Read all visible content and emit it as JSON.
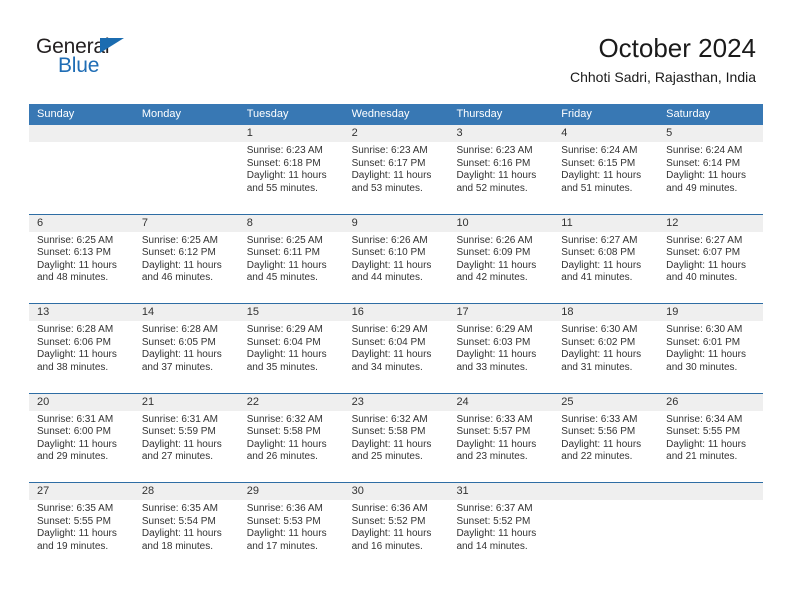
{
  "brand": {
    "name_part1": "General",
    "name_part2": "Blue"
  },
  "header": {
    "month_title": "October 2024",
    "location": "Chhoti Sadri, Rajasthan, India"
  },
  "colors": {
    "header_band": "#3878b4",
    "row_divider": "#2e6da4",
    "daynum_band": "#efefef",
    "brand_blue": "#1f6db5",
    "text": "#333333"
  },
  "day_names": [
    "Sunday",
    "Monday",
    "Tuesday",
    "Wednesday",
    "Thursday",
    "Friday",
    "Saturday"
  ],
  "labels": {
    "sunrise_prefix": "Sunrise:",
    "sunset_prefix": "Sunset:",
    "daylight_prefix": "Daylight:"
  },
  "weeks": [
    [
      {
        "empty": true,
        "day": "",
        "sunrise": "",
        "sunset": "",
        "daylight_line1": "",
        "daylight_line2": ""
      },
      {
        "empty": true,
        "day": "",
        "sunrise": "",
        "sunset": "",
        "daylight_line1": "",
        "daylight_line2": ""
      },
      {
        "empty": false,
        "day": "1",
        "sunrise": "Sunrise: 6:23 AM",
        "sunset": "Sunset: 6:18 PM",
        "daylight_line1": "Daylight: 11 hours",
        "daylight_line2": "and 55 minutes."
      },
      {
        "empty": false,
        "day": "2",
        "sunrise": "Sunrise: 6:23 AM",
        "sunset": "Sunset: 6:17 PM",
        "daylight_line1": "Daylight: 11 hours",
        "daylight_line2": "and 53 minutes."
      },
      {
        "empty": false,
        "day": "3",
        "sunrise": "Sunrise: 6:23 AM",
        "sunset": "Sunset: 6:16 PM",
        "daylight_line1": "Daylight: 11 hours",
        "daylight_line2": "and 52 minutes."
      },
      {
        "empty": false,
        "day": "4",
        "sunrise": "Sunrise: 6:24 AM",
        "sunset": "Sunset: 6:15 PM",
        "daylight_line1": "Daylight: 11 hours",
        "daylight_line2": "and 51 minutes."
      },
      {
        "empty": false,
        "day": "5",
        "sunrise": "Sunrise: 6:24 AM",
        "sunset": "Sunset: 6:14 PM",
        "daylight_line1": "Daylight: 11 hours",
        "daylight_line2": "and 49 minutes."
      }
    ],
    [
      {
        "empty": false,
        "day": "6",
        "sunrise": "Sunrise: 6:25 AM",
        "sunset": "Sunset: 6:13 PM",
        "daylight_line1": "Daylight: 11 hours",
        "daylight_line2": "and 48 minutes."
      },
      {
        "empty": false,
        "day": "7",
        "sunrise": "Sunrise: 6:25 AM",
        "sunset": "Sunset: 6:12 PM",
        "daylight_line1": "Daylight: 11 hours",
        "daylight_line2": "and 46 minutes."
      },
      {
        "empty": false,
        "day": "8",
        "sunrise": "Sunrise: 6:25 AM",
        "sunset": "Sunset: 6:11 PM",
        "daylight_line1": "Daylight: 11 hours",
        "daylight_line2": "and 45 minutes."
      },
      {
        "empty": false,
        "day": "9",
        "sunrise": "Sunrise: 6:26 AM",
        "sunset": "Sunset: 6:10 PM",
        "daylight_line1": "Daylight: 11 hours",
        "daylight_line2": "and 44 minutes."
      },
      {
        "empty": false,
        "day": "10",
        "sunrise": "Sunrise: 6:26 AM",
        "sunset": "Sunset: 6:09 PM",
        "daylight_line1": "Daylight: 11 hours",
        "daylight_line2": "and 42 minutes."
      },
      {
        "empty": false,
        "day": "11",
        "sunrise": "Sunrise: 6:27 AM",
        "sunset": "Sunset: 6:08 PM",
        "daylight_line1": "Daylight: 11 hours",
        "daylight_line2": "and 41 minutes."
      },
      {
        "empty": false,
        "day": "12",
        "sunrise": "Sunrise: 6:27 AM",
        "sunset": "Sunset: 6:07 PM",
        "daylight_line1": "Daylight: 11 hours",
        "daylight_line2": "and 40 minutes."
      }
    ],
    [
      {
        "empty": false,
        "day": "13",
        "sunrise": "Sunrise: 6:28 AM",
        "sunset": "Sunset: 6:06 PM",
        "daylight_line1": "Daylight: 11 hours",
        "daylight_line2": "and 38 minutes."
      },
      {
        "empty": false,
        "day": "14",
        "sunrise": "Sunrise: 6:28 AM",
        "sunset": "Sunset: 6:05 PM",
        "daylight_line1": "Daylight: 11 hours",
        "daylight_line2": "and 37 minutes."
      },
      {
        "empty": false,
        "day": "15",
        "sunrise": "Sunrise: 6:29 AM",
        "sunset": "Sunset: 6:04 PM",
        "daylight_line1": "Daylight: 11 hours",
        "daylight_line2": "and 35 minutes."
      },
      {
        "empty": false,
        "day": "16",
        "sunrise": "Sunrise: 6:29 AM",
        "sunset": "Sunset: 6:04 PM",
        "daylight_line1": "Daylight: 11 hours",
        "daylight_line2": "and 34 minutes."
      },
      {
        "empty": false,
        "day": "17",
        "sunrise": "Sunrise: 6:29 AM",
        "sunset": "Sunset: 6:03 PM",
        "daylight_line1": "Daylight: 11 hours",
        "daylight_line2": "and 33 minutes."
      },
      {
        "empty": false,
        "day": "18",
        "sunrise": "Sunrise: 6:30 AM",
        "sunset": "Sunset: 6:02 PM",
        "daylight_line1": "Daylight: 11 hours",
        "daylight_line2": "and 31 minutes."
      },
      {
        "empty": false,
        "day": "19",
        "sunrise": "Sunrise: 6:30 AM",
        "sunset": "Sunset: 6:01 PM",
        "daylight_line1": "Daylight: 11 hours",
        "daylight_line2": "and 30 minutes."
      }
    ],
    [
      {
        "empty": false,
        "day": "20",
        "sunrise": "Sunrise: 6:31 AM",
        "sunset": "Sunset: 6:00 PM",
        "daylight_line1": "Daylight: 11 hours",
        "daylight_line2": "and 29 minutes."
      },
      {
        "empty": false,
        "day": "21",
        "sunrise": "Sunrise: 6:31 AM",
        "sunset": "Sunset: 5:59 PM",
        "daylight_line1": "Daylight: 11 hours",
        "daylight_line2": "and 27 minutes."
      },
      {
        "empty": false,
        "day": "22",
        "sunrise": "Sunrise: 6:32 AM",
        "sunset": "Sunset: 5:58 PM",
        "daylight_line1": "Daylight: 11 hours",
        "daylight_line2": "and 26 minutes."
      },
      {
        "empty": false,
        "day": "23",
        "sunrise": "Sunrise: 6:32 AM",
        "sunset": "Sunset: 5:58 PM",
        "daylight_line1": "Daylight: 11 hours",
        "daylight_line2": "and 25 minutes."
      },
      {
        "empty": false,
        "day": "24",
        "sunrise": "Sunrise: 6:33 AM",
        "sunset": "Sunset: 5:57 PM",
        "daylight_line1": "Daylight: 11 hours",
        "daylight_line2": "and 23 minutes."
      },
      {
        "empty": false,
        "day": "25",
        "sunrise": "Sunrise: 6:33 AM",
        "sunset": "Sunset: 5:56 PM",
        "daylight_line1": "Daylight: 11 hours",
        "daylight_line2": "and 22 minutes."
      },
      {
        "empty": false,
        "day": "26",
        "sunrise": "Sunrise: 6:34 AM",
        "sunset": "Sunset: 5:55 PM",
        "daylight_line1": "Daylight: 11 hours",
        "daylight_line2": "and 21 minutes."
      }
    ],
    [
      {
        "empty": false,
        "day": "27",
        "sunrise": "Sunrise: 6:35 AM",
        "sunset": "Sunset: 5:55 PM",
        "daylight_line1": "Daylight: 11 hours",
        "daylight_line2": "and 19 minutes."
      },
      {
        "empty": false,
        "day": "28",
        "sunrise": "Sunrise: 6:35 AM",
        "sunset": "Sunset: 5:54 PM",
        "daylight_line1": "Daylight: 11 hours",
        "daylight_line2": "and 18 minutes."
      },
      {
        "empty": false,
        "day": "29",
        "sunrise": "Sunrise: 6:36 AM",
        "sunset": "Sunset: 5:53 PM",
        "daylight_line1": "Daylight: 11 hours",
        "daylight_line2": "and 17 minutes."
      },
      {
        "empty": false,
        "day": "30",
        "sunrise": "Sunrise: 6:36 AM",
        "sunset": "Sunset: 5:52 PM",
        "daylight_line1": "Daylight: 11 hours",
        "daylight_line2": "and 16 minutes."
      },
      {
        "empty": false,
        "day": "31",
        "sunrise": "Sunrise: 6:37 AM",
        "sunset": "Sunset: 5:52 PM",
        "daylight_line1": "Daylight: 11 hours",
        "daylight_line2": "and 14 minutes."
      },
      {
        "empty": true,
        "day": "",
        "sunrise": "",
        "sunset": "",
        "daylight_line1": "",
        "daylight_line2": ""
      },
      {
        "empty": true,
        "day": "",
        "sunrise": "",
        "sunset": "",
        "daylight_line1": "",
        "daylight_line2": ""
      }
    ]
  ]
}
